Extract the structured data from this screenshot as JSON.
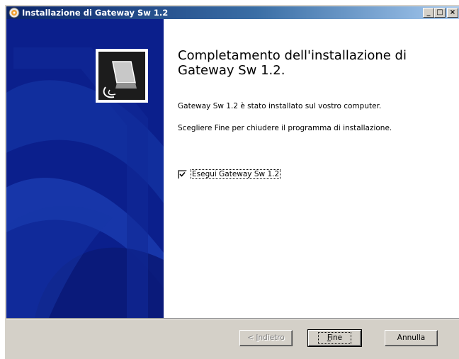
{
  "window": {
    "title": "Installazione di Gateway Sw 1.2",
    "controls": {
      "minimize_glyph": "_",
      "maximize_glyph": "□",
      "close_glyph": "×"
    }
  },
  "content": {
    "heading": "Completamento dell'installazione di Gateway Sw 1.2.",
    "paragraph_installed": "Gateway Sw 1.2 è stato installato sul vostro computer.",
    "paragraph_instruction": "Scegliere Fine per chiudere il programma di installazione.",
    "run_checkbox": {
      "label": "Esegui Gateway Sw 1.2",
      "checked": true
    }
  },
  "buttons": {
    "back": {
      "prefix": "< ",
      "accel": "I",
      "rest": "ndietro",
      "enabled": false
    },
    "finish": {
      "accel": "F",
      "rest": "ine"
    },
    "cancel": {
      "label": "Annulla"
    }
  },
  "colors": {
    "sidebar": "#0b1f8c",
    "titlebar_start": "#0a246a",
    "titlebar_end": "#a6caf0"
  },
  "icons": {
    "title": "installer-icon",
    "sidebar": "computer-install-icon",
    "check": "checkmark-icon"
  }
}
